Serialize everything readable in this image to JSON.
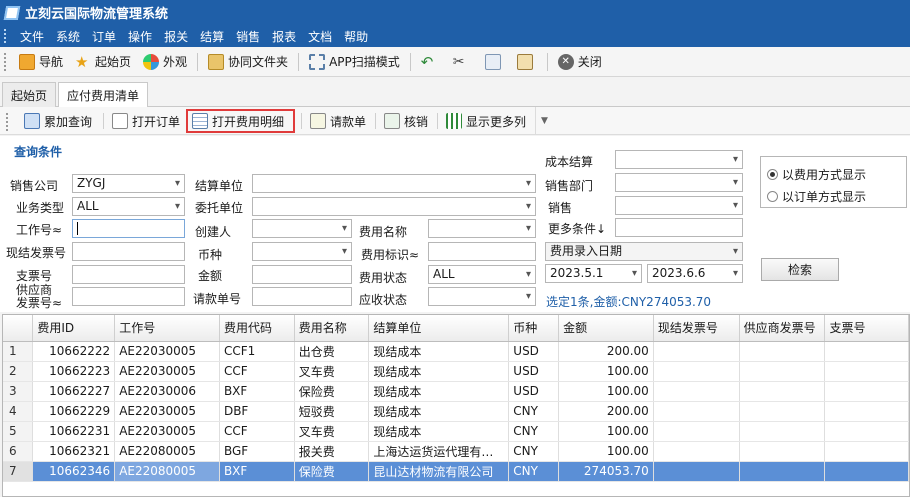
{
  "app": {
    "title": "立刻云国际物流管理系统"
  },
  "menu": [
    "文件",
    "系统",
    "订单",
    "操作",
    "报关",
    "结算",
    "销售",
    "报表",
    "文档",
    "帮助"
  ],
  "toolbar": {
    "items": [
      {
        "label": "导航",
        "icon": "navigation-icon"
      },
      {
        "label": "起始页",
        "icon": "star-icon"
      },
      {
        "label": "外观",
        "icon": "palette-icon"
      },
      {
        "label": "协同文件夹",
        "icon": "folder-icon"
      },
      {
        "label": "APP扫描模式",
        "icon": "scan-icon"
      },
      {
        "label": "",
        "icon": "undo-icon"
      },
      {
        "label": "",
        "icon": "cut-icon"
      },
      {
        "label": "",
        "icon": "copy-icon"
      },
      {
        "label": "",
        "icon": "paste-icon"
      },
      {
        "label": "关闭",
        "icon": "close-icon"
      }
    ]
  },
  "tabs": [
    {
      "label": "起始页"
    },
    {
      "label": "应付费用清单",
      "active": true
    }
  ],
  "actions": {
    "refresh": "累加查询",
    "open_order": "打开订单",
    "open_detail": "打开费用明细",
    "invoice_request": "请款单",
    "verify": "核销",
    "more_columns": "显示更多列"
  },
  "query": {
    "title": "查询条件",
    "labels": {
      "sales_company": "销售公司",
      "business_type": "业务类型",
      "job_no": "工作号≈",
      "cash_invoice": "现结发票号",
      "check_no": "支票号",
      "supplier_invoice": "供应商\n发票号≈",
      "settle_unit": "结算单位",
      "entrust_unit": "委托单位",
      "creator": "创建人",
      "currency": "币种",
      "amount": "金额",
      "request_no": "请款单号",
      "fee_name": "费用名称",
      "fee_flag": "费用标识≈",
      "fee_status": "费用状态",
      "receivable_status": "应收状态",
      "cost_settle": "成本结算",
      "sales_dept": "销售部门",
      "sales": "销售",
      "more_conditions": "更多条件↓"
    },
    "values": {
      "sales_company": "ZYGJ",
      "business_type": "ALL",
      "fee_status": "ALL",
      "date_type": "费用录入日期",
      "date_from": "2023.5.1",
      "date_to": "2023.6.6"
    },
    "radio": {
      "by_fee": "以费用方式显示",
      "by_order": "以订单方式显示"
    },
    "search_button": "检索",
    "summary": "选定1条,金额:CNY274053.70"
  },
  "grid": {
    "columns": [
      "",
      "费用ID",
      "工作号",
      "费用代码",
      "费用名称",
      "结算单位",
      "币种",
      "金额",
      "现结发票号",
      "供应商发票号",
      "支票号"
    ],
    "rows": [
      [
        "1",
        "10662222",
        "AE22030005",
        "CCF1",
        "出仓费",
        "现结成本",
        "USD",
        "200.00",
        "",
        "",
        ""
      ],
      [
        "2",
        "10662223",
        "AE22030005",
        "CCF",
        "叉车费",
        "现结成本",
        "USD",
        "100.00",
        "",
        "",
        ""
      ],
      [
        "3",
        "10662227",
        "AE22030006",
        "BXF",
        "保险费",
        "现结成本",
        "USD",
        "100.00",
        "",
        "",
        ""
      ],
      [
        "4",
        "10662229",
        "AE22030005",
        "DBF",
        "短驳费",
        "现结成本",
        "CNY",
        "200.00",
        "",
        "",
        ""
      ],
      [
        "5",
        "10662231",
        "AE22030005",
        "CCF",
        "叉车费",
        "现结成本",
        "CNY",
        "100.00",
        "",
        "",
        ""
      ],
      [
        "6",
        "10662321",
        "AE22080005",
        "BGF",
        "报关费",
        "上海达运货运代理有…",
        "CNY",
        "100.00",
        "",
        "",
        ""
      ],
      [
        "7",
        "10662346",
        "AE22080005",
        "BXF",
        "保险费",
        "昆山达材物流有限公司",
        "CNY",
        "274053.70",
        "",
        "",
        ""
      ]
    ]
  }
}
